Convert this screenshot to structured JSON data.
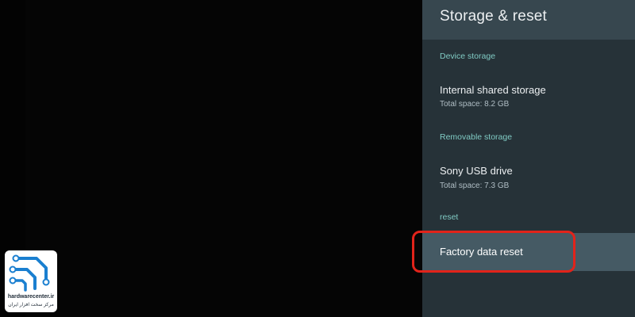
{
  "header": {
    "title": "Storage & reset"
  },
  "sections": {
    "device_storage_label": "Device storage",
    "removable_storage_label": "Removable storage",
    "reset_label": "reset"
  },
  "items": {
    "internal": {
      "title": "Internal shared storage",
      "subtitle": "Total space: 8.2 GB"
    },
    "usb": {
      "title": "Sony USB drive",
      "subtitle": "Total space: 7.3 GB"
    },
    "factory_reset": {
      "title": "Factory data reset"
    }
  },
  "logo": {
    "site": "hardwarecenter.ir",
    "tagline": "مرکز سخت افزار ایران"
  },
  "colors": {
    "panel_bg": "#263238",
    "header_bg": "#37474f",
    "focused_bg": "#455a64",
    "section_accent": "#80cbc4",
    "highlight_border": "#e2231a",
    "logo_blue": "#1a7fd0"
  }
}
